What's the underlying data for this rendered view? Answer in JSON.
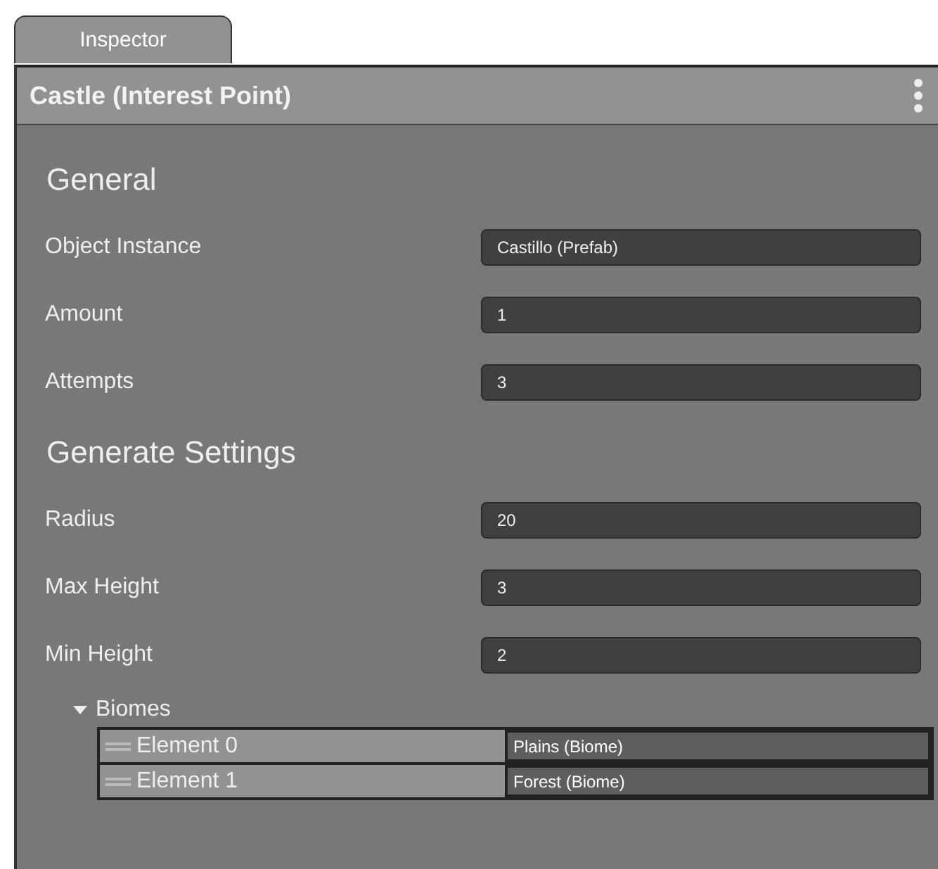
{
  "tabs": [
    {
      "label": "Inspector",
      "selected": true
    }
  ],
  "header": {
    "title": "Castle (Interest Point)"
  },
  "sections": [
    {
      "heading": "General",
      "fields": [
        {
          "label": "Object Instance",
          "value": "Castillo (Prefab)"
        },
        {
          "label": "Amount",
          "value": "1"
        },
        {
          "label": "Attempts",
          "value": "3"
        }
      ]
    },
    {
      "heading": "Generate Settings",
      "fields": [
        {
          "label": "Radius",
          "value": "20"
        },
        {
          "label": "Max Height",
          "value": "3"
        },
        {
          "label": "Min Height",
          "value": "2"
        }
      ]
    }
  ],
  "biomes": {
    "label": "Biomes",
    "expanded": true,
    "elements": [
      {
        "label": "Element 0",
        "value": "Plains (Biome)"
      },
      {
        "label": "Element 1",
        "value": "Forest (Biome)"
      }
    ]
  }
}
